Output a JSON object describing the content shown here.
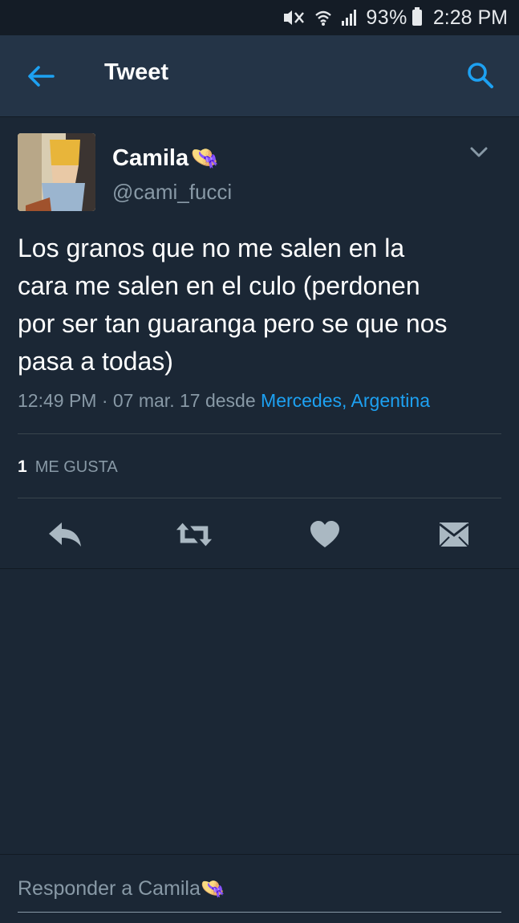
{
  "status_bar": {
    "battery_percent": "93%",
    "time": "2:28 PM"
  },
  "app_bar": {
    "title": "Tweet"
  },
  "tweet": {
    "display_name": "Camila",
    "name_emoji": "👒",
    "handle": "@cami_fucci",
    "text": "Los granos que no me salen en la\ncara me salen en el culo (perdonen\npor ser tan guaranga pero se que nos\npasa a todas)",
    "time": "12:49 PM · 07 mar. 17",
    "source_prefix": "desde",
    "location": "Mercedes, Argentina",
    "like_count": "1",
    "like_label": "ME GUSTA"
  },
  "reply": {
    "placeholder": "Responder a Camila",
    "placeholder_emoji": "👒"
  },
  "colors": {
    "background": "#1b2735",
    "appbar": "#243447",
    "accent": "#1da1f2",
    "secondary_text": "#8899a6",
    "icon_gray": "#aab8c2"
  }
}
